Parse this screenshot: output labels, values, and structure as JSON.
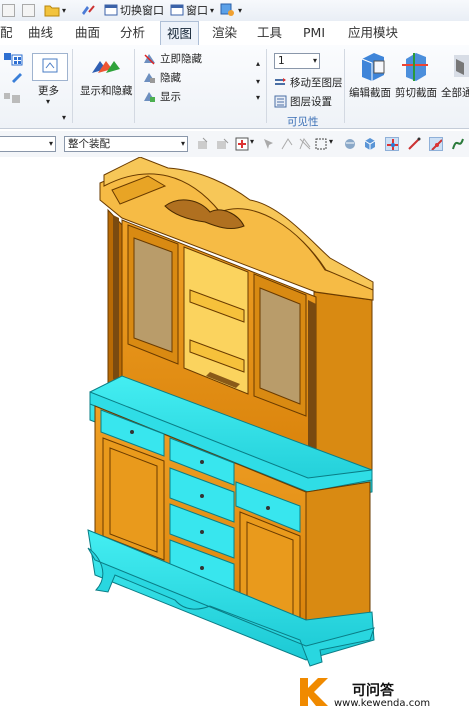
{
  "quick_access": {
    "switch_window": "切换窗口",
    "window": "窗口"
  },
  "tabs": [
    {
      "label": "配"
    },
    {
      "label": "曲线"
    },
    {
      "label": "曲面"
    },
    {
      "label": "分析"
    },
    {
      "label": "视图"
    },
    {
      "label": "渲染"
    },
    {
      "label": "工具"
    },
    {
      "label": "PMI"
    },
    {
      "label": "应用模块"
    }
  ],
  "active_tab": "视图",
  "ribbon": {
    "more": "更多",
    "show_hide": "显示和隐藏",
    "immediate_hide": "立即隐藏",
    "hide": "隐藏",
    "show": "显示",
    "layer_value": "1",
    "move_to_layer": "移动至图层",
    "layer_settings": "图层设置",
    "visibility_group": "可见性",
    "edit_section": "编辑截面",
    "clip_section": "剪切截面",
    "all_pass": "全部通"
  },
  "toolbar2": {
    "filter_value": "",
    "assembly_scope": "整个装配"
  },
  "watermark": {
    "letter": "K",
    "title": "可问答",
    "url": "www.kewenda.com"
  },
  "colors": {
    "cabinet_orange": "#e8960e",
    "cabinet_gold": "#f2b53a",
    "cyan_highlight": "#33e3ec",
    "active_tab_bg": "#eef3fa",
    "visibility_caption": "#3a6fb5"
  }
}
